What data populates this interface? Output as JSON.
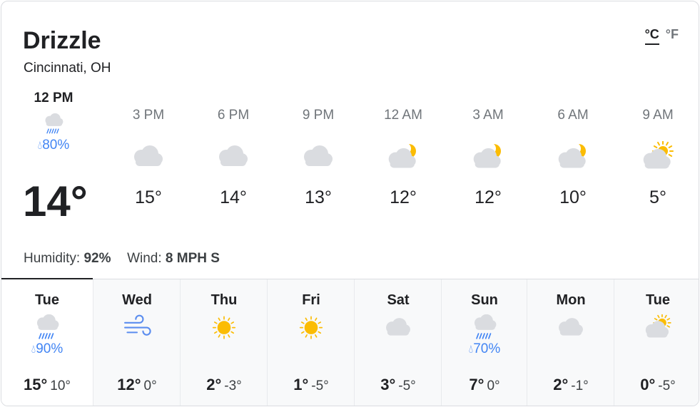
{
  "header": {
    "condition": "Drizzle",
    "location": "Cincinnati, OH"
  },
  "units": {
    "celsius": "°C",
    "fahrenheit": "°F",
    "selected": "celsius"
  },
  "now": {
    "time": "12 PM",
    "icon": "rain-cloud-icon",
    "precip": "80%",
    "temp": "14°"
  },
  "hourly": [
    {
      "time": "3 PM",
      "icon": "cloud-icon",
      "temp": "15°"
    },
    {
      "time": "6 PM",
      "icon": "cloud-icon",
      "temp": "14°"
    },
    {
      "time": "9 PM",
      "icon": "cloud-icon",
      "temp": "13°"
    },
    {
      "time": "12 AM",
      "icon": "moon-cloud-icon",
      "temp": "12°"
    },
    {
      "time": "3 AM",
      "icon": "moon-cloud-icon",
      "temp": "12°"
    },
    {
      "time": "6 AM",
      "icon": "moon-cloud-icon",
      "temp": "10°"
    },
    {
      "time": "9 AM",
      "icon": "sun-cloud-icon",
      "temp": "5°"
    }
  ],
  "details": {
    "humidity_label": "Humidity:",
    "humidity": "92%",
    "wind_label": "Wind:",
    "wind": "8 MPH S"
  },
  "daily": [
    {
      "day": "Tue",
      "icon": "rain-cloud-icon",
      "precip": "90%",
      "hi": "15°",
      "lo": "10°",
      "selected": true
    },
    {
      "day": "Wed",
      "icon": "wind-icon",
      "precip": "",
      "hi": "12°",
      "lo": "0°"
    },
    {
      "day": "Thu",
      "icon": "sun-icon",
      "precip": "",
      "hi": "2°",
      "lo": "-3°"
    },
    {
      "day": "Fri",
      "icon": "sun-icon",
      "precip": "",
      "hi": "1°",
      "lo": "-5°"
    },
    {
      "day": "Sat",
      "icon": "cloud-icon",
      "precip": "",
      "hi": "3°",
      "lo": "-5°"
    },
    {
      "day": "Sun",
      "icon": "rain-cloud-icon",
      "precip": "70%",
      "hi": "7°",
      "lo": "0°"
    },
    {
      "day": "Mon",
      "icon": "cloud-icon",
      "precip": "",
      "hi": "2°",
      "lo": "-1°"
    },
    {
      "day": "Tue",
      "icon": "sun-cloud-icon",
      "precip": "",
      "hi": "0°",
      "lo": "-5°"
    }
  ],
  "colors": {
    "precip": "#4285f4",
    "cloud": "#dadce0",
    "sun": "#fbbc04",
    "wind": "#5b8def"
  }
}
